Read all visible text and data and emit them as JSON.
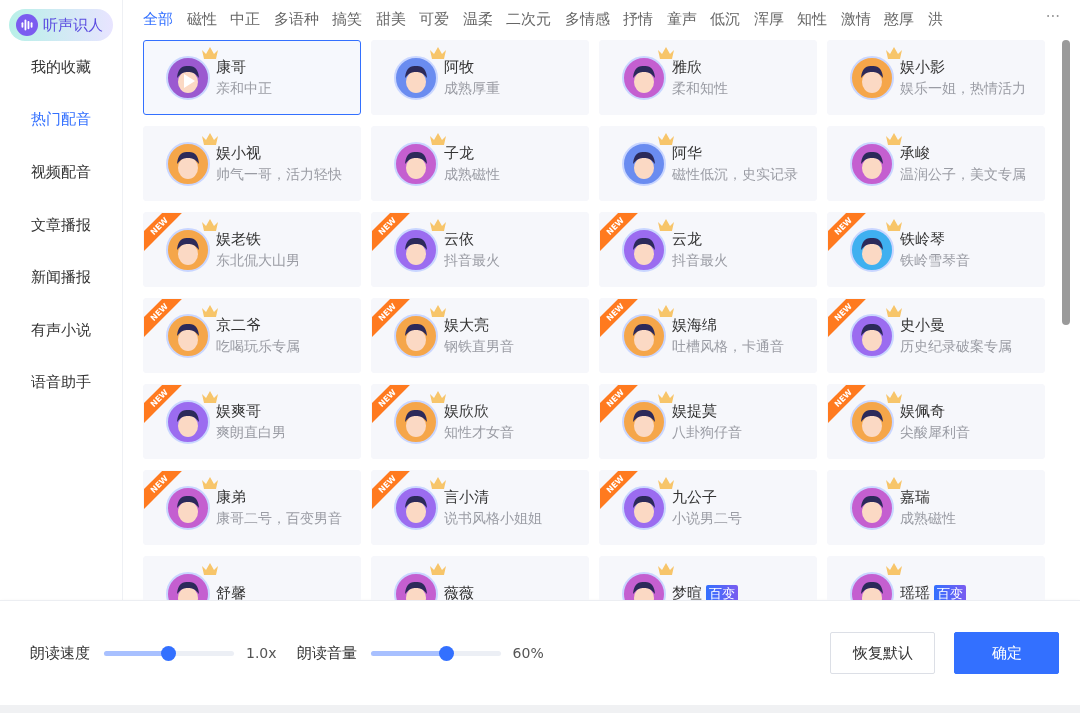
{
  "logo": {
    "label": "听声识人"
  },
  "sidebar": {
    "items": [
      {
        "label": "我的收藏",
        "selected": false
      },
      {
        "label": "热门配音",
        "selected": true
      },
      {
        "label": "视频配音",
        "selected": false
      },
      {
        "label": "文章播报",
        "selected": false
      },
      {
        "label": "新闻播报",
        "selected": false
      },
      {
        "label": "有声小说",
        "selected": false
      },
      {
        "label": "语音助手",
        "selected": false
      }
    ]
  },
  "tabs": [
    {
      "label": "全部",
      "selected": true
    },
    {
      "label": "磁性",
      "selected": false
    },
    {
      "label": "中正",
      "selected": false
    },
    {
      "label": "多语种",
      "selected": false
    },
    {
      "label": "搞笑",
      "selected": false
    },
    {
      "label": "甜美",
      "selected": false
    },
    {
      "label": "可爱",
      "selected": false
    },
    {
      "label": "温柔",
      "selected": false
    },
    {
      "label": "二次元",
      "selected": false
    },
    {
      "label": "多情感",
      "selected": false
    },
    {
      "label": "抒情",
      "selected": false
    },
    {
      "label": "童声",
      "selected": false
    },
    {
      "label": "低沉",
      "selected": false
    },
    {
      "label": "浑厚",
      "selected": false
    },
    {
      "label": "知性",
      "selected": false
    },
    {
      "label": "激情",
      "selected": false
    },
    {
      "label": "憨厚",
      "selected": false
    },
    {
      "label": "洪",
      "selected": false
    }
  ],
  "more_tabs": "···",
  "voices": [
    {
      "name": "康哥",
      "desc": "亲和中正",
      "selected": true,
      "color": "#9b59d0"
    },
    {
      "name": "阿牧",
      "desc": "成熟厚重",
      "selected": false,
      "color": "#6a8cf0"
    },
    {
      "name": "雅欣",
      "desc": "柔和知性",
      "selected": false,
      "color": "#c45fd0"
    },
    {
      "name": "娱小影",
      "desc": "娱乐一姐，热情活力",
      "selected": false,
      "color": "#f5a64a"
    },
    {
      "name": "娱小视",
      "desc": "帅气一哥，活力轻快",
      "selected": false,
      "color": "#f5a64a"
    },
    {
      "name": "子龙",
      "desc": "成熟磁性",
      "selected": false,
      "color": "#c45fd0"
    },
    {
      "name": "阿华",
      "desc": "磁性低沉，史实记录",
      "selected": false,
      "color": "#6a8cf0"
    },
    {
      "name": "承峻",
      "desc": "温润公子，美文专属",
      "selected": false,
      "color": "#c45fd0"
    },
    {
      "name": "娱老铁",
      "desc": "东北侃大山男",
      "selected": false,
      "ribbon": "NEW",
      "color": "#f5a64a"
    },
    {
      "name": "云依",
      "desc": "抖音最火",
      "selected": false,
      "ribbon": "NEW",
      "color": "#9b6cf0"
    },
    {
      "name": "云龙",
      "desc": "抖音最火",
      "selected": false,
      "ribbon": "NEW",
      "color": "#9b6cf0"
    },
    {
      "name": "铁岭琴",
      "desc": "铁岭雪琴音",
      "selected": false,
      "ribbon": "NEW",
      "color": "#3fb0f0"
    },
    {
      "name": "京二爷",
      "desc": "吃喝玩乐专属",
      "selected": false,
      "ribbon": "NEW",
      "color": "#f5a64a"
    },
    {
      "name": "娱大亮",
      "desc": "钢铁直男音",
      "selected": false,
      "ribbon": "NEW",
      "color": "#f5a64a"
    },
    {
      "name": "娱海绵",
      "desc": "吐槽风格，卡通音",
      "selected": false,
      "ribbon": "NEW",
      "color": "#f5a64a"
    },
    {
      "name": "史小曼",
      "desc": "历史纪录破案专属",
      "selected": false,
      "ribbon": "NEW",
      "color": "#9b6cf0"
    },
    {
      "name": "娱爽哥",
      "desc": "爽朗直白男",
      "selected": false,
      "ribbon": "NEW",
      "color": "#9b6cf0"
    },
    {
      "name": "娱欣欣",
      "desc": "知性才女音",
      "selected": false,
      "ribbon": "NEW",
      "color": "#f5a64a"
    },
    {
      "name": "娱提莫",
      "desc": "八卦狗仔音",
      "selected": false,
      "ribbon": "NEW",
      "color": "#f5a64a"
    },
    {
      "name": "娱佩奇",
      "desc": "尖酸犀利音",
      "selected": false,
      "ribbon": "NEW",
      "color": "#f5a64a"
    },
    {
      "name": "康弟",
      "desc": "康哥二号，百变男音",
      "selected": false,
      "ribbon": "NEW",
      "color": "#c45fd0"
    },
    {
      "name": "言小清",
      "desc": "说书风格小姐姐",
      "selected": false,
      "ribbon": "NEW",
      "color": "#9b6cf0"
    },
    {
      "name": "九公子",
      "desc": "小说男二号",
      "selected": false,
      "ribbon": "NEW",
      "color": "#9b6cf0"
    },
    {
      "name": "嘉瑞",
      "desc": "成熟磁性",
      "selected": false,
      "color": "#c45fd0"
    },
    {
      "name": "舒馨",
      "selected": false,
      "color": "#c45fd0"
    },
    {
      "name": "薇薇",
      "selected": false,
      "color": "#c45fd0"
    },
    {
      "name": "梦暄",
      "badge": "百变",
      "selected": false,
      "color": "#c45fd0"
    },
    {
      "name": "瑶瑶",
      "badge": "百变",
      "selected": false,
      "color": "#c45fd0"
    }
  ],
  "footer": {
    "speed": {
      "label": "朗读速度",
      "level": 0.49,
      "reading": "1.0x"
    },
    "volume": {
      "label": "朗读音量",
      "level": 0.58,
      "reading": "60%"
    },
    "buttons": [
      {
        "label": "恢复默认",
        "kind": "secondary"
      },
      {
        "label": "确定",
        "kind": "primary"
      }
    ]
  }
}
